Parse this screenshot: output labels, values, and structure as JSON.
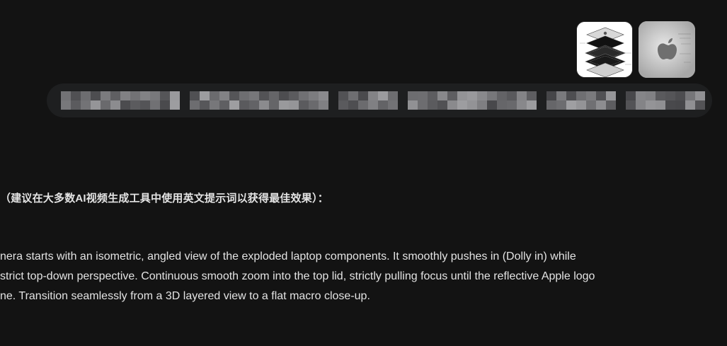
{
  "attachments": [
    {
      "name": "exploded-laptop-diagram"
    },
    {
      "name": "apple-logo-macro"
    }
  ],
  "response": {
    "heading": "（建议在大多数AI视频生成工具中使用英文提示词以获得最佳效果）：",
    "paragraph_lines": [
      "nera starts with an isometric, angled view of the exploded laptop components. It smoothly pushes in (Dolly in) while",
      "strict top-down perspective. Continuous smooth zoom into the top lid, strictly pulling focus until the reflective Apple logo",
      "ne. Transition seamlessly from a 3D layered view to a flat macro close-up."
    ]
  },
  "colors": {
    "background": "#131313",
    "bubble": "#1e1f20",
    "text": "#e3e3e3"
  }
}
